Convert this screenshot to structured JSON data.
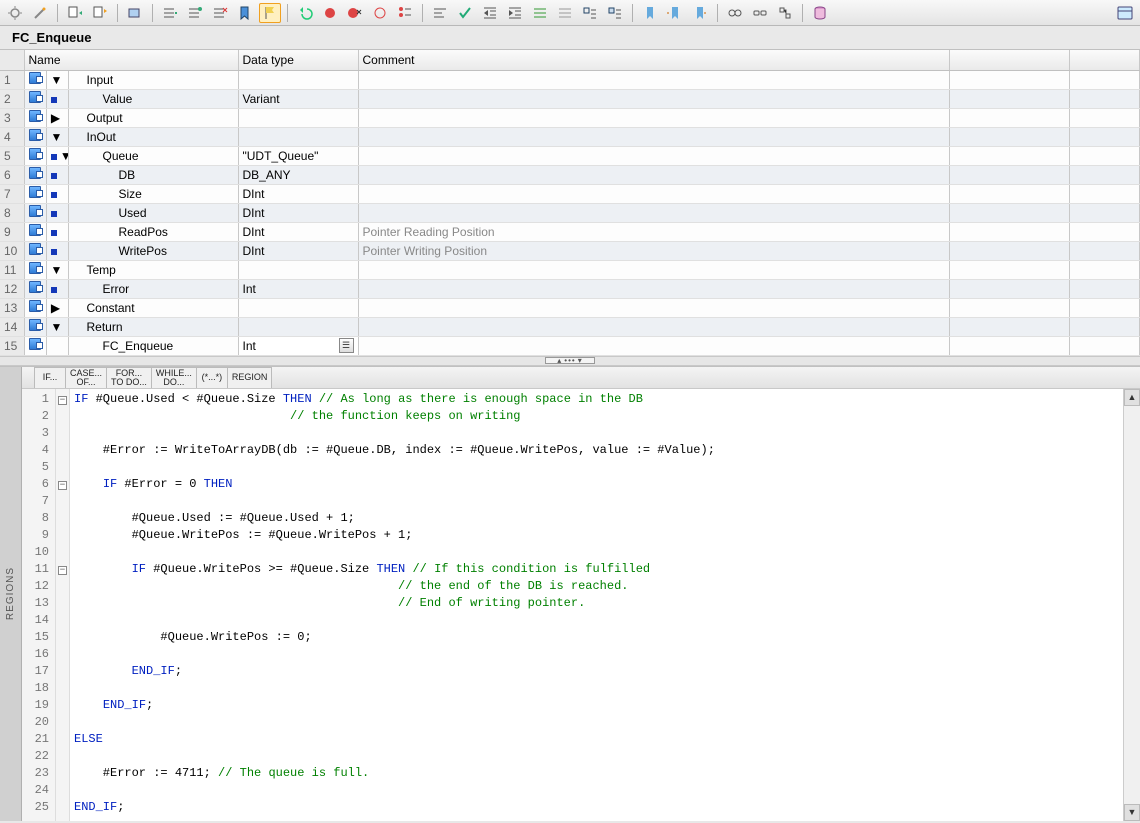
{
  "title": "FC_Enqueue",
  "headers": {
    "name": "Name",
    "datatype": "Data type",
    "comment": "Comment"
  },
  "snips": {
    "if": "IF...",
    "case_a": "CASE...",
    "case_b": "OF...",
    "for_a": "FOR...",
    "for_b": "TO DO...",
    "while_a": "WHILE...",
    "while_b": "DO...",
    "cmt": "(*...*)",
    "region": "REGION"
  },
  "regions": "REGIONS",
  "rows": [
    {
      "n": 1,
      "ico": true,
      "bul": "exp-d",
      "name": "Input",
      "dt": "",
      "cm": "",
      "ind": 1,
      "alt": false
    },
    {
      "n": 2,
      "ico": true,
      "bul": "sq",
      "name": "Value",
      "dt": "Variant",
      "cm": "",
      "ind": 2,
      "alt": true
    },
    {
      "n": 3,
      "ico": true,
      "bul": "exp-r",
      "name": "Output",
      "dt": "",
      "cm": "",
      "ind": 1,
      "alt": false
    },
    {
      "n": 4,
      "ico": true,
      "bul": "exp-d",
      "name": "InOut",
      "dt": "",
      "cm": "",
      "ind": 1,
      "alt": true
    },
    {
      "n": 5,
      "ico": true,
      "bul": "sq-exp",
      "name": "Queue",
      "dt": "\"UDT_Queue\"",
      "cm": "",
      "ind": 2,
      "alt": false
    },
    {
      "n": 6,
      "ico": true,
      "bul": "sq",
      "name": "DB",
      "dt": "DB_ANY",
      "cm": "",
      "ind": 3,
      "alt": true
    },
    {
      "n": 7,
      "ico": true,
      "bul": "sq",
      "name": "Size",
      "dt": "DInt",
      "cm": "",
      "ind": 3,
      "alt": false
    },
    {
      "n": 8,
      "ico": true,
      "bul": "sq",
      "name": "Used",
      "dt": "DInt",
      "cm": "",
      "ind": 3,
      "alt": true
    },
    {
      "n": 9,
      "ico": true,
      "bul": "sq",
      "name": "ReadPos",
      "dt": "DInt",
      "cm": "Pointer Reading Position",
      "ind": 3,
      "alt": false
    },
    {
      "n": 10,
      "ico": true,
      "bul": "sq",
      "name": "WritePos",
      "dt": "DInt",
      "cm": "Pointer Writing Position",
      "ind": 3,
      "alt": true
    },
    {
      "n": 11,
      "ico": true,
      "bul": "exp-d",
      "name": "Temp",
      "dt": "",
      "cm": "",
      "ind": 1,
      "alt": false
    },
    {
      "n": 12,
      "ico": true,
      "bul": "sq",
      "name": "Error",
      "dt": "Int",
      "cm": "",
      "ind": 2,
      "alt": true
    },
    {
      "n": 13,
      "ico": true,
      "bul": "exp-r",
      "name": "Constant",
      "dt": "",
      "cm": "",
      "ind": 1,
      "alt": false
    },
    {
      "n": 14,
      "ico": true,
      "bul": "exp-d",
      "name": "Return",
      "dt": "",
      "cm": "",
      "ind": 1,
      "alt": true
    },
    {
      "n": 15,
      "ico": true,
      "bul": "none",
      "name": "FC_Enqueue",
      "dt": "Int",
      "cm": "",
      "ind": 2,
      "alt": false,
      "edit": true
    }
  ],
  "code": {
    "l1a": "IF",
    "l1b": " #Queue.Used < #Queue.Size ",
    "l1c": "THEN",
    "l1d": " // As long as there is enough space in the DB",
    "l2": "                              // the function keeps on writing",
    "l4a": "    #Error := WriteToArrayDB(db := #Queue.DB, index := #Queue.WritePos, value := #Value);",
    "l6a": "    ",
    "l6b": "IF",
    "l6c": " #Error = 0 ",
    "l6d": "THEN",
    "l8": "        #Queue.Used := #Queue.Used + 1;",
    "l9": "        #Queue.WritePos := #Queue.WritePos + 1;",
    "l11a": "        ",
    "l11b": "IF",
    "l11c": " #Queue.WritePos >= #Queue.Size ",
    "l11d": "THEN",
    "l11e": " // If this condition is fulfilled",
    "l12": "                                             // the end of the DB is reached.",
    "l13": "                                             // End of writing pointer.",
    "l15": "            #Queue.WritePos := 0;",
    "l17a": "        ",
    "l17b": "END_IF",
    "l19a": "    ",
    "l19b": "END_IF",
    "l21": "ELSE",
    "l23a": "    #Error := 4711; ",
    "l23b": "// The queue is full.",
    "l25": "END_IF"
  }
}
